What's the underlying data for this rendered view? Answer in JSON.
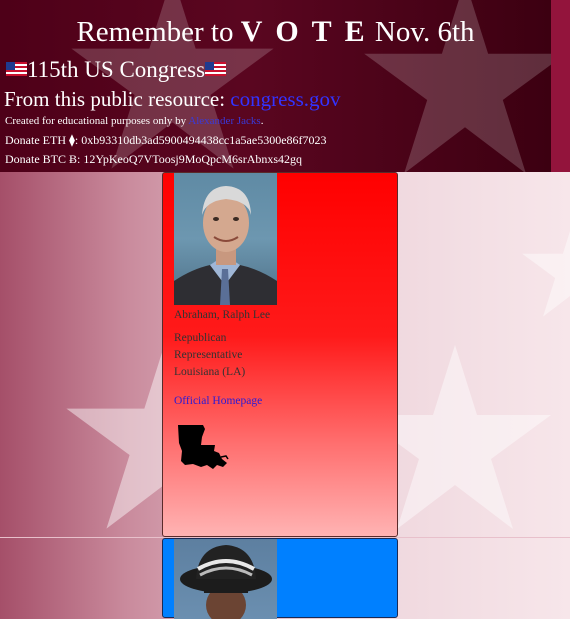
{
  "header": {
    "title_prefix": "Remember to ",
    "title_vote": "V O T E",
    "title_suffix": " Nov. 6th",
    "congress": "115th US Congress",
    "source_text": "From this public resource: ",
    "source_link": "congress.gov",
    "edu_text": "Created for educational purposes only by ",
    "edu_author": "Alexander Jacks",
    "edu_period": ".",
    "donate_eth": "Donate ETH ⧫: 0xb93310db3ad5900494438cc1a5ae5300e86f7023",
    "donate_btc": "Donate BTC Ƀ: 12YpKeoQ7VToosj9MoQpcM6srAbnxs42gq"
  },
  "members": [
    {
      "name": "Abraham, Ralph Lee",
      "party": "Republican",
      "chamber": "Representative",
      "state": "Louisiana (LA)",
      "homepage_label": "Official Homepage",
      "card_color": "#ff0000",
      "state_icon": "louisiana-map-icon"
    },
    {
      "card_color": "#0080ff"
    }
  ]
}
